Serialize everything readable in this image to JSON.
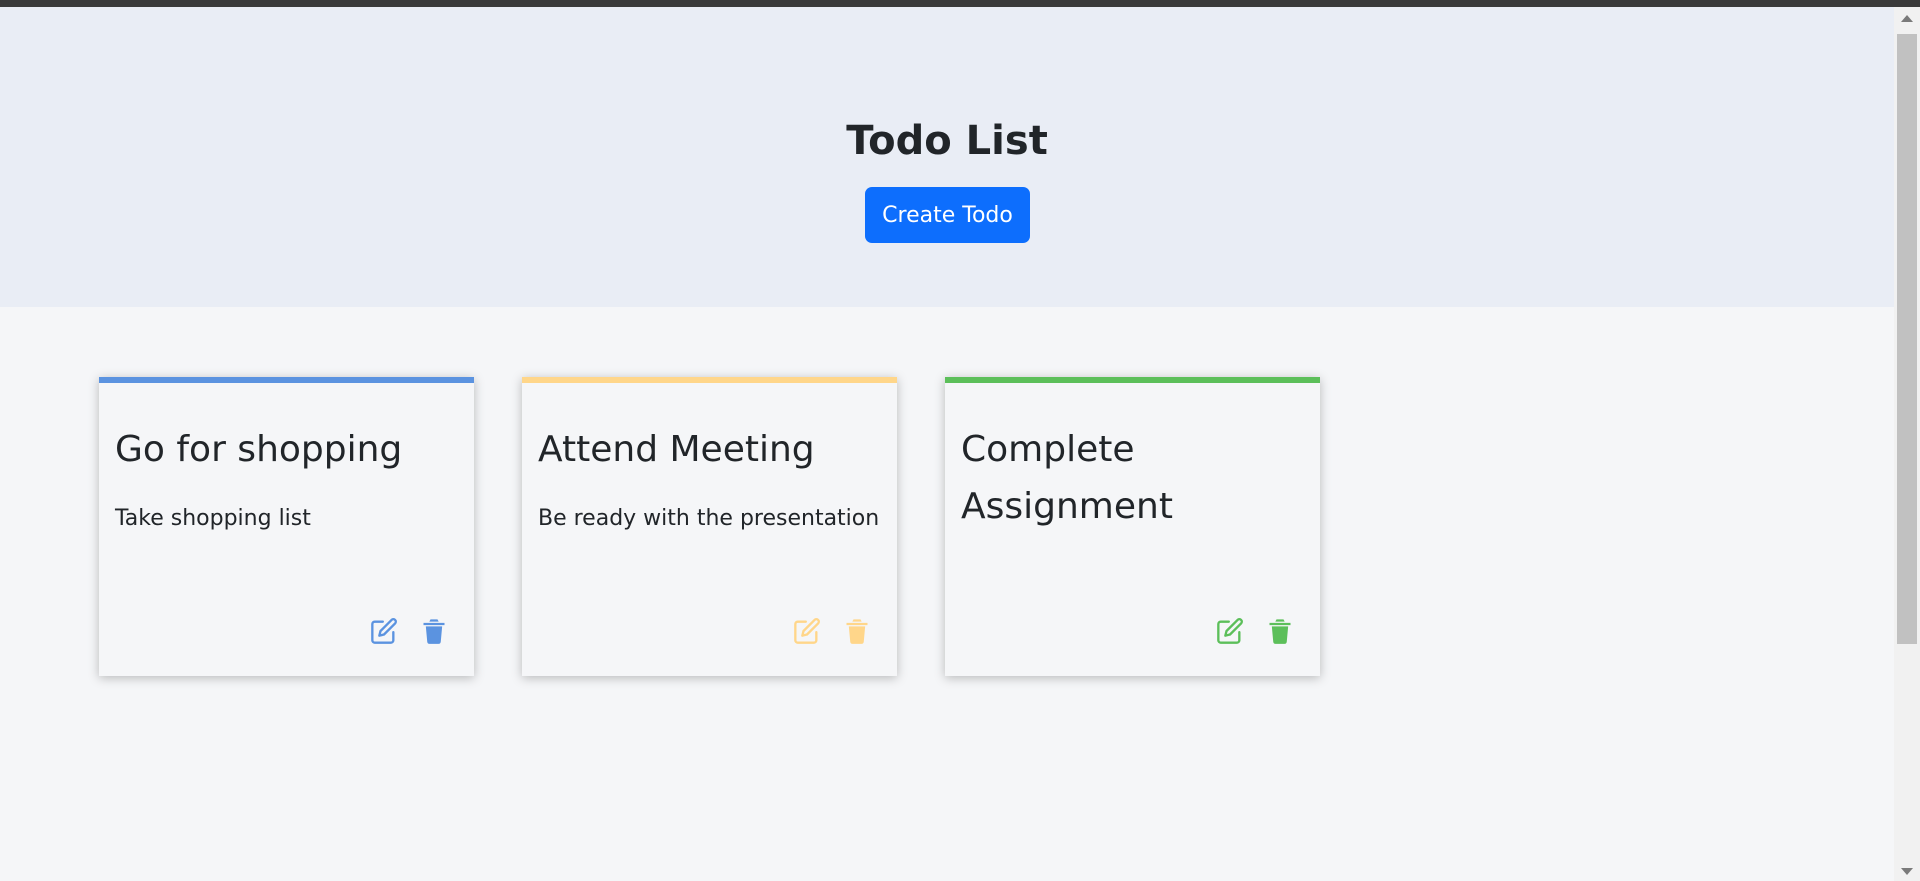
{
  "header": {
    "title": "Todo List",
    "create_button_label": "Create Todo"
  },
  "todos": [
    {
      "title": "Go for shopping",
      "description": "Take shopping list",
      "accent_color": "#5b93e0",
      "icon_color": "#5b93e0",
      "edit_icon": "edit-icon",
      "delete_icon": "trash-icon"
    },
    {
      "title": "Attend Meeting",
      "description": "Be ready with the presentation",
      "accent_color": "#ffd68a",
      "icon_color": "#ffd68a",
      "edit_icon": "edit-icon",
      "delete_icon": "trash-icon"
    },
    {
      "title": "Complete Assignment",
      "description": "",
      "accent_color": "#5cbf5a",
      "icon_color": "#5cbf5a",
      "edit_icon": "edit-icon",
      "delete_icon": "trash-icon"
    }
  ],
  "colors": {
    "primary_button": "#0d6efd",
    "header_background": "#e9edf5",
    "page_background": "#f5f6f8"
  }
}
